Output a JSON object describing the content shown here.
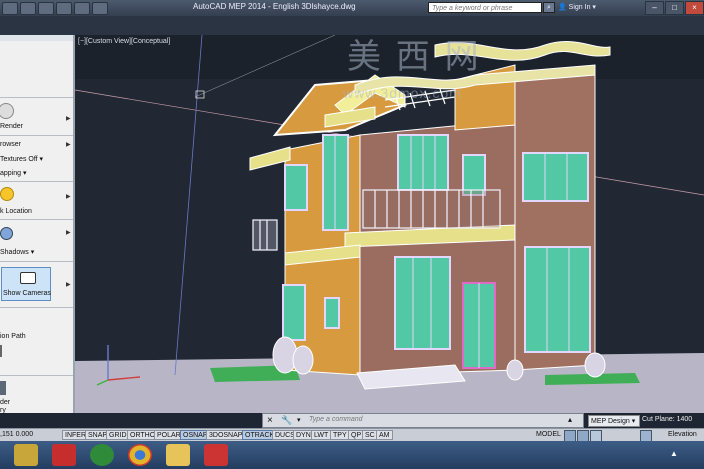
{
  "window": {
    "title": "AutoCAD MEP 2014 - English   3Dlshayce.dwg",
    "search_placeholder": "Type a keyword or phrase",
    "sign_in": "Sign In"
  },
  "viewport": {
    "label": "[−][Custom View][Conceptual]",
    "watermark_cn": "美 西 网",
    "watermark_url": "www.3dmox.com"
  },
  "palette": {
    "render": "Render",
    "browser": "rowser",
    "textures": "Textures Off",
    "mapping": "apping",
    "location": "k Location",
    "shadows": "Shadows",
    "show_cameras": "Show Cameras",
    "motion_path": "ion Path",
    "bottom1": "der",
    "bottom2": "ry"
  },
  "command": {
    "placeholder": "Type a command",
    "workspace": "MEP Design",
    "cut_plane": "Cut Plane:  1400"
  },
  "status": {
    "coords": ",151   0.000",
    "toggles": [
      "INFER",
      "SNAP",
      "GRID",
      "ORTHO",
      "POLAR",
      "OSNAP",
      "3DOSNAP",
      "OTRACK",
      "DUCS",
      "DYN",
      "LWT",
      "TPY",
      "QP",
      "SC",
      "AM"
    ],
    "model": "MODEL",
    "elevation": "Elevation"
  },
  "icons": {
    "search": "search-icon",
    "camera": "camera-icon",
    "sun": "sun-icon",
    "light": "light-icon",
    "ucs": "ucs-icon"
  }
}
